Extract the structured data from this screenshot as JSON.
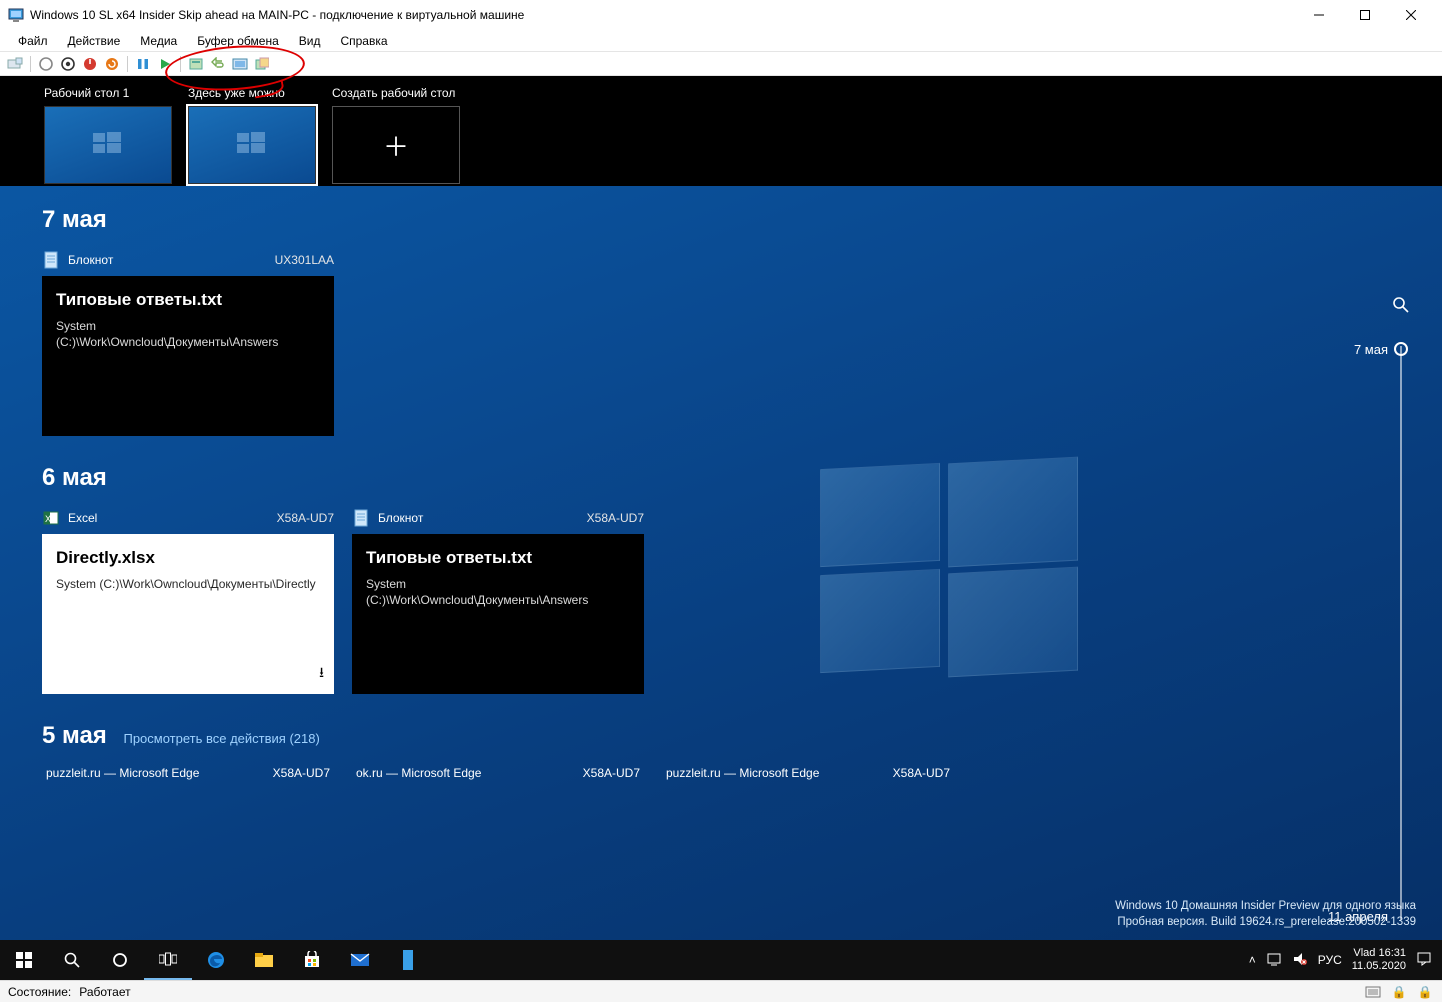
{
  "host": {
    "title": "Windows 10 SL x64 Insider Skip ahead на MAIN-PC - подключение к виртуальной машине",
    "menu": [
      "Файл",
      "Действие",
      "Медиа",
      "Буфер обмена",
      "Вид",
      "Справка"
    ],
    "status_label": "Состояние:",
    "status_value": "Работает"
  },
  "desktops": {
    "items": [
      {
        "label": "Рабочий стол 1"
      },
      {
        "label": "Здесь уже можно"
      }
    ],
    "new_label": "Создать рабочий стол"
  },
  "timeline": {
    "groups": [
      {
        "heading": "7 мая",
        "items": [
          {
            "app": "Блокнот",
            "pc": "UX301LAA",
            "icon": "notepad",
            "title": "Типовые ответы.txt",
            "path": "System (C:)\\Work\\Owncloud\\Документы\\Answers",
            "theme": "black"
          }
        ]
      },
      {
        "heading": "6 мая",
        "items": [
          {
            "app": "Excel",
            "pc": "X58A-UD7",
            "icon": "excel",
            "title": "Directly.xlsx",
            "path": "System (C:)\\Work\\Owncloud\\Документы\\Directly",
            "theme": "white",
            "download": true
          },
          {
            "app": "Блокнот",
            "pc": "X58A-UD7",
            "icon": "notepad",
            "title": "Типовые ответы.txt",
            "path": "System (C:)\\Work\\Owncloud\\Документы\\Answers",
            "theme": "black"
          }
        ]
      }
    ],
    "more_heading": "5 мая",
    "more_link": "Просмотреть все действия (218)",
    "small": [
      {
        "name": "puzzleit.ru — Microsoft Edge",
        "pc": "X58A-UD7"
      },
      {
        "name": "ok.ru — Microsoft Edge",
        "pc": "X58A-UD7"
      },
      {
        "name": "puzzleit.ru — Microsoft Edge",
        "pc": "X58A-UD7"
      }
    ],
    "scrub": {
      "top": "7 мая",
      "bottom": "11 апреля"
    }
  },
  "watermark": {
    "line1": "Windows 10 Домашняя Insider Preview для одного языка",
    "line2": "Пробная версия. Build 19624.rs_prerelease.200502-1339"
  },
  "taskbar": {
    "tray_lang": "РУС",
    "clock_user": "Vlad 16:31",
    "clock_date": "11.05.2020"
  }
}
